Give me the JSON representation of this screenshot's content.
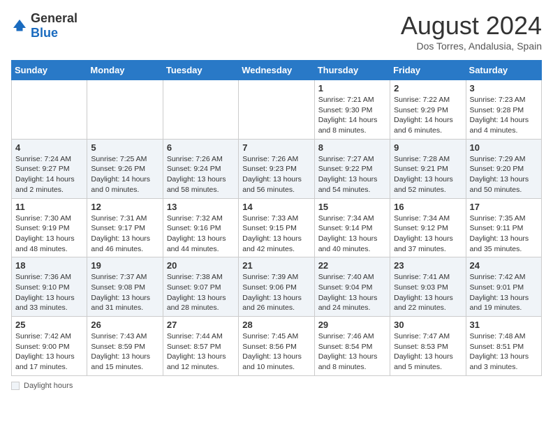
{
  "header": {
    "logo_general": "General",
    "logo_blue": "Blue",
    "month_year": "August 2024",
    "location": "Dos Torres, Andalusia, Spain"
  },
  "days_of_week": [
    "Sunday",
    "Monday",
    "Tuesday",
    "Wednesday",
    "Thursday",
    "Friday",
    "Saturday"
  ],
  "weeks": [
    [
      {
        "day": "",
        "info": ""
      },
      {
        "day": "",
        "info": ""
      },
      {
        "day": "",
        "info": ""
      },
      {
        "day": "",
        "info": ""
      },
      {
        "day": "1",
        "info": "Sunrise: 7:21 AM\nSunset: 9:30 PM\nDaylight: 14 hours and 8 minutes."
      },
      {
        "day": "2",
        "info": "Sunrise: 7:22 AM\nSunset: 9:29 PM\nDaylight: 14 hours and 6 minutes."
      },
      {
        "day": "3",
        "info": "Sunrise: 7:23 AM\nSunset: 9:28 PM\nDaylight: 14 hours and 4 minutes."
      }
    ],
    [
      {
        "day": "4",
        "info": "Sunrise: 7:24 AM\nSunset: 9:27 PM\nDaylight: 14 hours and 2 minutes."
      },
      {
        "day": "5",
        "info": "Sunrise: 7:25 AM\nSunset: 9:26 PM\nDaylight: 14 hours and 0 minutes."
      },
      {
        "day": "6",
        "info": "Sunrise: 7:26 AM\nSunset: 9:24 PM\nDaylight: 13 hours and 58 minutes."
      },
      {
        "day": "7",
        "info": "Sunrise: 7:26 AM\nSunset: 9:23 PM\nDaylight: 13 hours and 56 minutes."
      },
      {
        "day": "8",
        "info": "Sunrise: 7:27 AM\nSunset: 9:22 PM\nDaylight: 13 hours and 54 minutes."
      },
      {
        "day": "9",
        "info": "Sunrise: 7:28 AM\nSunset: 9:21 PM\nDaylight: 13 hours and 52 minutes."
      },
      {
        "day": "10",
        "info": "Sunrise: 7:29 AM\nSunset: 9:20 PM\nDaylight: 13 hours and 50 minutes."
      }
    ],
    [
      {
        "day": "11",
        "info": "Sunrise: 7:30 AM\nSunset: 9:19 PM\nDaylight: 13 hours and 48 minutes."
      },
      {
        "day": "12",
        "info": "Sunrise: 7:31 AM\nSunset: 9:17 PM\nDaylight: 13 hours and 46 minutes."
      },
      {
        "day": "13",
        "info": "Sunrise: 7:32 AM\nSunset: 9:16 PM\nDaylight: 13 hours and 44 minutes."
      },
      {
        "day": "14",
        "info": "Sunrise: 7:33 AM\nSunset: 9:15 PM\nDaylight: 13 hours and 42 minutes."
      },
      {
        "day": "15",
        "info": "Sunrise: 7:34 AM\nSunset: 9:14 PM\nDaylight: 13 hours and 40 minutes."
      },
      {
        "day": "16",
        "info": "Sunrise: 7:34 AM\nSunset: 9:12 PM\nDaylight: 13 hours and 37 minutes."
      },
      {
        "day": "17",
        "info": "Sunrise: 7:35 AM\nSunset: 9:11 PM\nDaylight: 13 hours and 35 minutes."
      }
    ],
    [
      {
        "day": "18",
        "info": "Sunrise: 7:36 AM\nSunset: 9:10 PM\nDaylight: 13 hours and 33 minutes."
      },
      {
        "day": "19",
        "info": "Sunrise: 7:37 AM\nSunset: 9:08 PM\nDaylight: 13 hours and 31 minutes."
      },
      {
        "day": "20",
        "info": "Sunrise: 7:38 AM\nSunset: 9:07 PM\nDaylight: 13 hours and 28 minutes."
      },
      {
        "day": "21",
        "info": "Sunrise: 7:39 AM\nSunset: 9:06 PM\nDaylight: 13 hours and 26 minutes."
      },
      {
        "day": "22",
        "info": "Sunrise: 7:40 AM\nSunset: 9:04 PM\nDaylight: 13 hours and 24 minutes."
      },
      {
        "day": "23",
        "info": "Sunrise: 7:41 AM\nSunset: 9:03 PM\nDaylight: 13 hours and 22 minutes."
      },
      {
        "day": "24",
        "info": "Sunrise: 7:42 AM\nSunset: 9:01 PM\nDaylight: 13 hours and 19 minutes."
      }
    ],
    [
      {
        "day": "25",
        "info": "Sunrise: 7:42 AM\nSunset: 9:00 PM\nDaylight: 13 hours and 17 minutes."
      },
      {
        "day": "26",
        "info": "Sunrise: 7:43 AM\nSunset: 8:59 PM\nDaylight: 13 hours and 15 minutes."
      },
      {
        "day": "27",
        "info": "Sunrise: 7:44 AM\nSunset: 8:57 PM\nDaylight: 13 hours and 12 minutes."
      },
      {
        "day": "28",
        "info": "Sunrise: 7:45 AM\nSunset: 8:56 PM\nDaylight: 13 hours and 10 minutes."
      },
      {
        "day": "29",
        "info": "Sunrise: 7:46 AM\nSunset: 8:54 PM\nDaylight: 13 hours and 8 minutes."
      },
      {
        "day": "30",
        "info": "Sunrise: 7:47 AM\nSunset: 8:53 PM\nDaylight: 13 hours and 5 minutes."
      },
      {
        "day": "31",
        "info": "Sunrise: 7:48 AM\nSunset: 8:51 PM\nDaylight: 13 hours and 3 minutes."
      }
    ]
  ],
  "footer": {
    "daylight_label": "Daylight hours"
  }
}
